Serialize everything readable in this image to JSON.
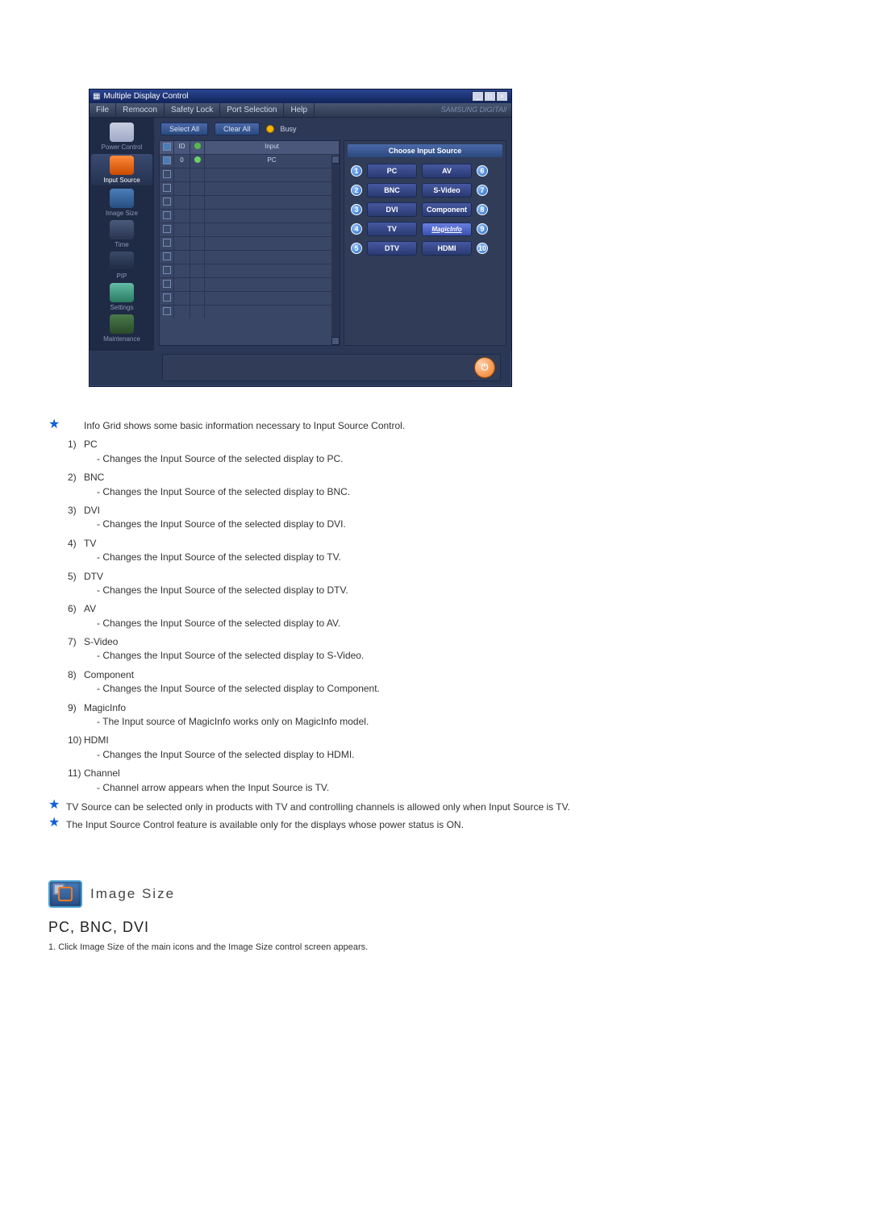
{
  "window": {
    "title": "Multiple Display Control",
    "menus": [
      "File",
      "Remocon",
      "Safety Lock",
      "Port Selection",
      "Help"
    ],
    "brand": "SAMSUNG DIGITAll"
  },
  "sidebar": [
    {
      "label": "Power Control",
      "cls": "pc-ic",
      "name": "sidebar-power-control"
    },
    {
      "label": "Input Source",
      "cls": "is-ic",
      "name": "sidebar-input-source",
      "active": true
    },
    {
      "label": "Image Size",
      "cls": "sz-ic",
      "name": "sidebar-image-size"
    },
    {
      "label": "Time",
      "cls": "tm-ic",
      "name": "sidebar-time"
    },
    {
      "label": "PIP",
      "cls": "pip-ic",
      "name": "sidebar-pip"
    },
    {
      "label": "Settings",
      "cls": "set-ic",
      "name": "sidebar-settings"
    },
    {
      "label": "Maintenance",
      "cls": "mt-ic",
      "name": "sidebar-maintenance"
    }
  ],
  "toolbar": {
    "select_all": "Select All",
    "clear_all": "Clear All",
    "busy": "Busy"
  },
  "grid": {
    "headers": {
      "chk": "✓",
      "id": "ID",
      "st": "",
      "input": "Input"
    },
    "first_row": {
      "id": "0",
      "input": "PC"
    }
  },
  "panel": {
    "title": "Choose Input Source",
    "rows": [
      {
        "left_num": "1",
        "left": "PC",
        "right": "AV",
        "right_num": "6",
        "right_cls": ""
      },
      {
        "left_num": "2",
        "left": "BNC",
        "right": "S-Video",
        "right_num": "7",
        "right_cls": ""
      },
      {
        "left_num": "3",
        "left": "DVI",
        "right": "Component",
        "right_num": "8",
        "right_cls": ""
      },
      {
        "left_num": "4",
        "left": "TV",
        "right": "MagicInfo",
        "right_num": "9",
        "right_cls": "magic"
      },
      {
        "left_num": "5",
        "left": "DTV",
        "right": "HDMI",
        "right_num": "10",
        "right_cls": ""
      }
    ]
  },
  "doc": {
    "intro": "Info Grid shows some basic information necessary to Input Source Control.",
    "items": [
      {
        "n": "1)",
        "t": "PC",
        "d": "- Changes the Input Source of the selected display to PC."
      },
      {
        "n": "2)",
        "t": "BNC",
        "d": "- Changes the Input Source of the selected display to BNC."
      },
      {
        "n": "3)",
        "t": "DVI",
        "d": "- Changes the Input Source of the selected display to DVI."
      },
      {
        "n": "4)",
        "t": "TV",
        "d": "- Changes the Input Source of the selected display to TV."
      },
      {
        "n": "5)",
        "t": "DTV",
        "d": "- Changes the Input Source of the selected display to DTV."
      },
      {
        "n": "6)",
        "t": "AV",
        "d": "- Changes the Input Source of the selected display to AV."
      },
      {
        "n": "7)",
        "t": "S-Video",
        "d": "- Changes the Input Source of the selected display to S-Video."
      },
      {
        "n": "8)",
        "t": "Component",
        "d": "- Changes the Input Source of the selected display to Component."
      },
      {
        "n": "9)",
        "t": "MagicInfo",
        "d": "- The Input source of MagicInfo works only on MagicInfo model."
      },
      {
        "n": "10)",
        "t": "HDMI",
        "d": "- Changes the Input Source of the selected display to HDMI."
      },
      {
        "n": "11)",
        "t": "Channel",
        "d": "- Channel arrow appears when the Input Source is TV."
      }
    ],
    "note1": "TV Source can be selected only in products with TV and controlling channels is allowed only when Input Source is TV.",
    "note2": "The Input Source Control feature is available only for the displays whose power status is ON."
  },
  "section": {
    "heading": "Image Size",
    "subhead": "PC, BNC, DVI",
    "step1": "1. Click Image Size of the main icons and the Image Size control screen appears."
  }
}
